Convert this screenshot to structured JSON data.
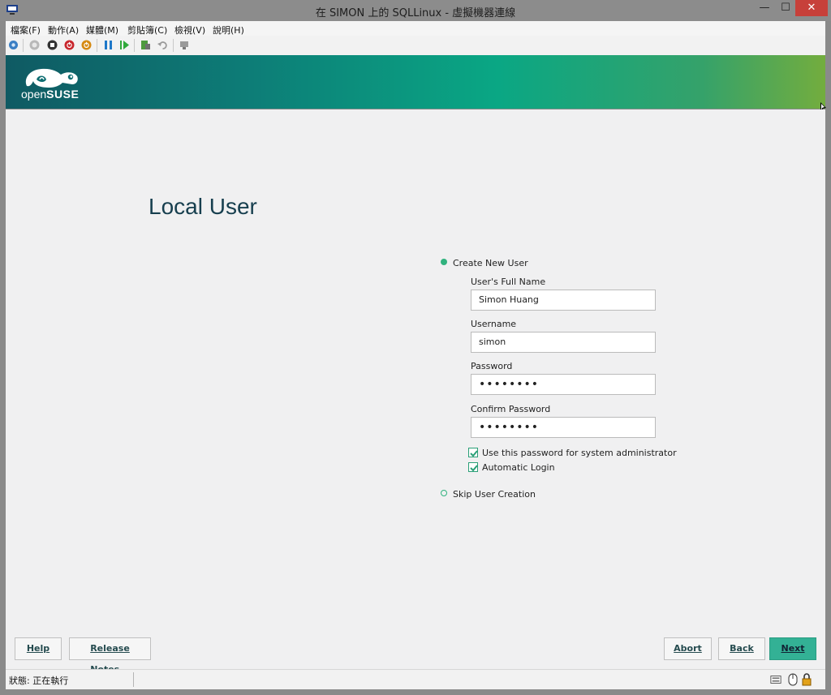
{
  "window": {
    "title": "在 SIMON 上的 SQLLinux - 虛擬機器連線",
    "minimize": "—",
    "maximize": "☐",
    "close": "✕"
  },
  "menubar": {
    "items": [
      "檔案(F)",
      "動作(A)",
      "媒體(M)",
      "剪貼簿(C)",
      "檢視(V)",
      "說明(H)"
    ]
  },
  "toolbar": {
    "icons": [
      "ctrl-alt-del-icon",
      "start-icon",
      "turn-off-icon",
      "shutdown-icon",
      "save-icon",
      "pause-icon",
      "resume-icon",
      "checkpoint-icon",
      "revert-icon",
      "enhanced-session-icon"
    ]
  },
  "brand": {
    "logo_prefix": "open",
    "logo_suffix": "SUSE"
  },
  "page": {
    "title": "Local User"
  },
  "form": {
    "create_new_user": "Create New User",
    "full_name_label": "User's Full Name",
    "full_name_value": "Simon Huang",
    "username_label": "Username",
    "username_value": "simon",
    "password_label": "Password",
    "password_value": "••••••••",
    "confirm_label": "Confirm Password",
    "confirm_value": "••••••••",
    "use_for_admin": "Use this password for system administrator",
    "auto_login": "Automatic Login",
    "skip_user": "Skip User Creation"
  },
  "buttons": {
    "help": "Help",
    "release_notes": "Release Notes...",
    "abort": "Abort",
    "back": "Back",
    "next": "Next"
  },
  "status": {
    "text": "狀態: 正在執行"
  },
  "colors": {
    "accent": "#30b27e",
    "title": "#173f4f",
    "banner_start": "#0f5a63",
    "banner_end": "#73ad3e"
  }
}
